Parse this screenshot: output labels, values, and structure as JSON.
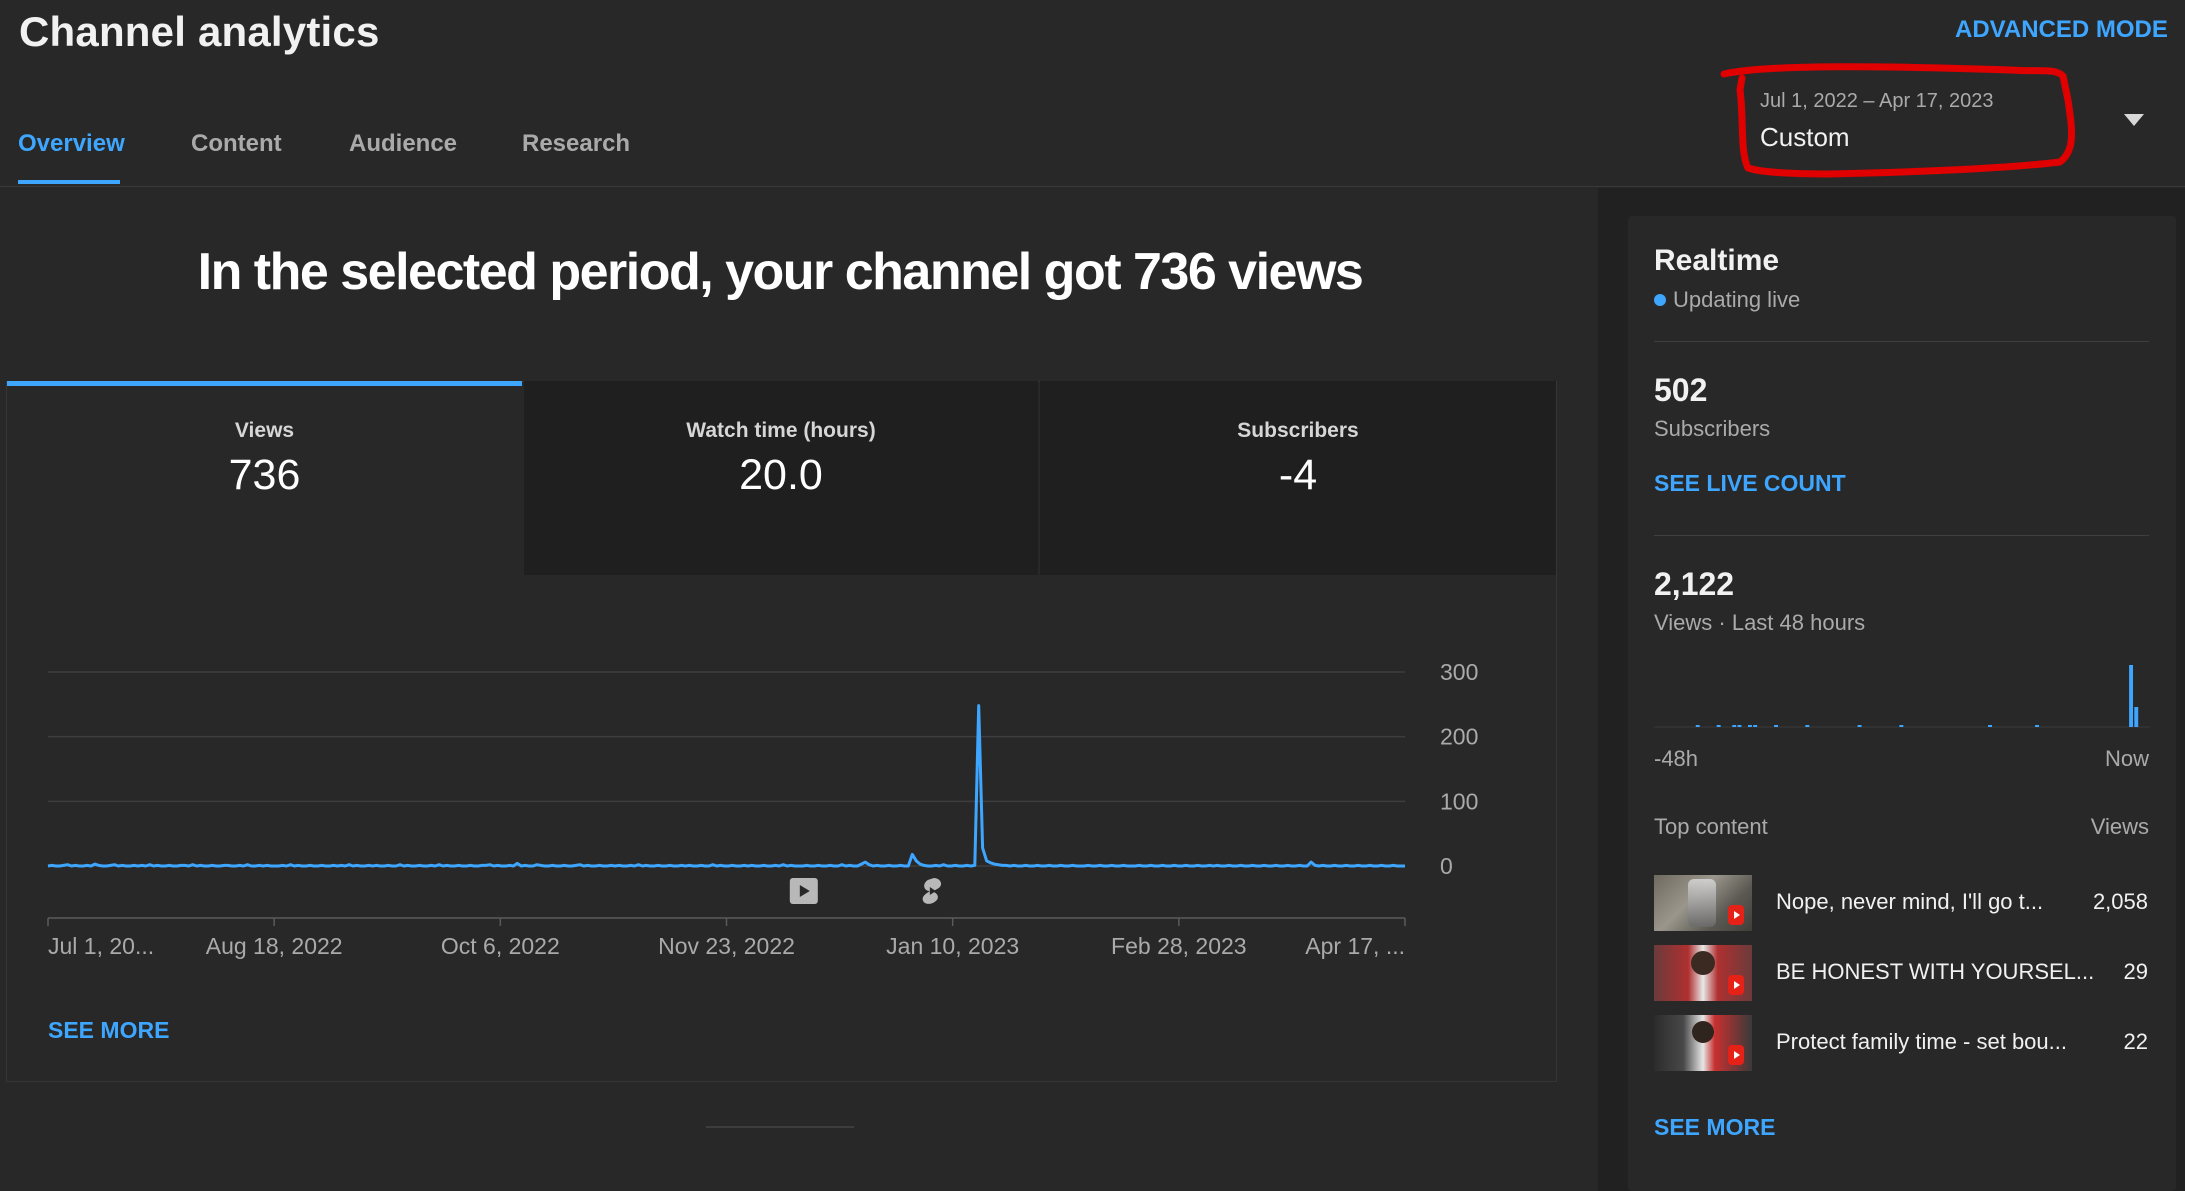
{
  "header": {
    "title": "Channel analytics",
    "advanced_mode": "ADVANCED MODE",
    "tabs": [
      {
        "label": "Overview",
        "active": true
      },
      {
        "label": "Content",
        "active": false
      },
      {
        "label": "Audience",
        "active": false
      },
      {
        "label": "Research",
        "active": false
      }
    ],
    "date_range": "Jul 1, 2022 – Apr 17, 2023",
    "date_label": "Custom"
  },
  "overview": {
    "headline": "In the selected period, your channel got 736 views",
    "metrics": [
      {
        "label": "Views",
        "value": "736",
        "selected": true
      },
      {
        "label": "Watch time (hours)",
        "value": "20.0",
        "selected": false
      },
      {
        "label": "Subscribers",
        "value": "-4",
        "selected": false
      }
    ],
    "see_more": "SEE MORE",
    "video_marker_icons": [
      "video-play-icon",
      "shorts-icon"
    ]
  },
  "chart_data": {
    "type": "line",
    "series": [
      {
        "values": [
          0,
          1,
          0,
          0,
          1,
          2,
          0,
          1,
          0,
          0,
          1,
          0,
          3,
          1,
          0,
          0,
          1,
          2,
          0,
          1,
          0,
          0,
          1,
          0,
          1,
          0,
          2,
          0,
          1,
          0,
          0,
          1,
          0,
          0,
          1,
          1,
          0,
          2,
          0,
          1,
          0,
          0,
          1,
          0,
          0,
          1,
          1,
          0,
          0,
          1,
          0,
          2,
          0,
          0,
          1,
          0,
          1,
          0,
          0,
          0,
          1,
          0,
          2,
          0,
          1,
          0,
          0,
          1,
          0,
          0,
          1,
          0,
          0,
          1,
          0,
          1,
          0,
          2,
          0,
          1,
          0,
          0,
          1,
          0,
          1,
          0,
          0,
          1,
          0,
          0,
          2,
          0,
          1,
          0,
          0,
          1,
          0,
          0,
          1,
          0,
          2,
          0,
          1,
          0,
          0,
          1,
          0,
          0,
          1,
          0,
          0,
          1,
          1,
          2,
          0,
          1,
          0,
          0,
          1,
          0,
          4,
          0,
          1,
          0,
          0,
          2,
          1,
          0,
          0,
          1,
          0,
          0,
          1,
          0,
          0,
          1,
          2,
          0,
          1,
          0,
          0,
          1,
          0,
          0,
          1,
          0,
          1,
          0,
          0,
          1,
          0,
          2,
          0,
          1,
          0,
          0,
          1,
          0,
          0,
          1,
          0,
          0,
          1,
          0,
          1,
          0,
          0,
          1,
          0,
          0,
          2,
          0,
          1,
          0,
          0,
          1,
          0,
          0,
          1,
          0,
          1,
          0,
          0,
          1,
          0,
          0,
          1,
          0,
          2,
          0,
          1,
          0,
          0,
          0,
          1,
          0,
          0,
          1,
          0,
          0,
          1,
          0,
          0,
          2,
          0,
          1,
          0,
          0,
          3,
          6,
          2,
          0,
          1,
          0,
          0,
          1,
          0,
          0,
          1,
          0,
          0,
          18,
          8,
          3,
          1,
          0,
          0,
          1,
          0,
          2,
          0,
          0,
          1,
          0,
          0,
          1,
          0,
          1,
          248,
          28,
          8,
          5,
          3,
          2,
          1,
          1,
          0,
          1,
          0,
          0,
          1,
          0,
          0,
          1,
          0,
          0,
          1,
          0,
          0,
          1,
          0,
          0,
          1,
          0,
          0,
          0,
          1,
          0,
          0,
          1,
          0,
          0,
          1,
          0,
          0,
          1,
          0,
          0,
          0,
          1,
          0,
          0,
          1,
          0,
          0,
          1,
          0,
          0,
          1,
          0,
          0,
          1,
          0,
          0,
          1,
          0,
          0,
          1,
          0,
          1,
          0,
          0,
          1,
          0,
          0,
          1,
          0,
          0,
          1,
          0,
          0,
          1,
          0,
          0,
          1,
          0,
          0,
          1,
          0,
          0,
          1,
          0,
          0,
          6,
          1,
          0,
          1,
          0,
          0,
          1,
          0,
          0,
          1,
          0,
          0,
          1,
          0,
          0,
          1,
          0,
          0,
          1,
          0,
          0,
          1,
          0,
          0,
          0
        ]
      }
    ],
    "x_labels": [
      "Jul 1, 20...",
      "Aug 18, 2022",
      "Oct 6, 2022",
      "Nov 23, 2022",
      "Jan 10, 2023",
      "Feb 28, 2023",
      "Apr 17, ..."
    ],
    "y_ticks": [
      "300",
      "200",
      "100",
      "0"
    ],
    "ylim": [
      0,
      300
    ],
    "spike_day": 226,
    "grid": true,
    "color": "#3ea6ff"
  },
  "realtime": {
    "title": "Realtime",
    "status": "Updating live",
    "subscribers_value": "502",
    "subscribers_label": "Subscribers",
    "see_live_count": "SEE LIVE COUNT",
    "views_value": "2,122",
    "views_label": "Views · Last 48 hours",
    "bars": [
      0,
      0,
      0,
      0,
      0,
      0,
      0,
      0,
      1,
      0,
      0,
      0,
      1,
      0,
      0,
      1,
      1,
      0,
      1,
      1,
      0,
      0,
      0,
      1,
      0,
      0,
      0,
      0,
      0,
      1,
      0,
      0,
      0,
      0,
      0,
      0,
      0,
      0,
      0,
      1,
      0,
      0,
      0,
      0,
      0,
      0,
      0,
      1,
      0,
      0,
      0,
      0,
      0,
      0,
      0,
      0,
      0,
      0,
      0,
      0,
      0,
      0,
      0,
      0,
      1,
      0,
      0,
      0,
      0,
      0,
      0,
      0,
      0,
      1,
      0,
      0,
      0,
      0,
      0,
      0,
      0,
      0,
      0,
      0,
      0,
      0,
      0,
      0,
      0,
      0,
      0,
      62,
      20,
      0,
      0
    ],
    "bar_start_label": "-48h",
    "bar_end_label": "Now",
    "top_content_label": "Top content",
    "views_col_label": "Views",
    "items": [
      {
        "title": "Nope, never mind, I'll go t...",
        "views": "2,058"
      },
      {
        "title": "BE HONEST WITH YOURSEL...",
        "views": "29"
      },
      {
        "title": "Protect family time - set bou...",
        "views": "22"
      }
    ],
    "see_more": "SEE MORE"
  },
  "colors": {
    "accent": "#3ea6ff",
    "annotation": "#e00000",
    "background": "#282828"
  }
}
